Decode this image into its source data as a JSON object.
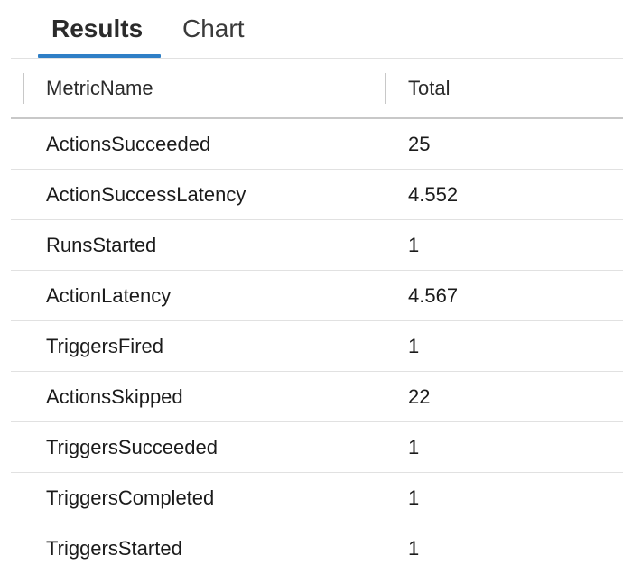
{
  "tabs": [
    {
      "label": "Results",
      "active": true
    },
    {
      "label": "Chart",
      "active": false
    }
  ],
  "colors": {
    "accent": "#2f7fc6",
    "divider": "#e1e1e1",
    "header_border": "#c8c8c8"
  },
  "table": {
    "columns": [
      "MetricName",
      "Total"
    ],
    "rows": [
      {
        "name": "ActionsSucceeded",
        "total": "25"
      },
      {
        "name": "ActionSuccessLatency",
        "total": "4.552"
      },
      {
        "name": "RunsStarted",
        "total": "1"
      },
      {
        "name": "ActionLatency",
        "total": "4.567"
      },
      {
        "name": "TriggersFired",
        "total": "1"
      },
      {
        "name": "ActionsSkipped",
        "total": "22"
      },
      {
        "name": "TriggersSucceeded",
        "total": "1"
      },
      {
        "name": "TriggersCompleted",
        "total": "1"
      },
      {
        "name": "TriggersStarted",
        "total": "1"
      }
    ]
  }
}
